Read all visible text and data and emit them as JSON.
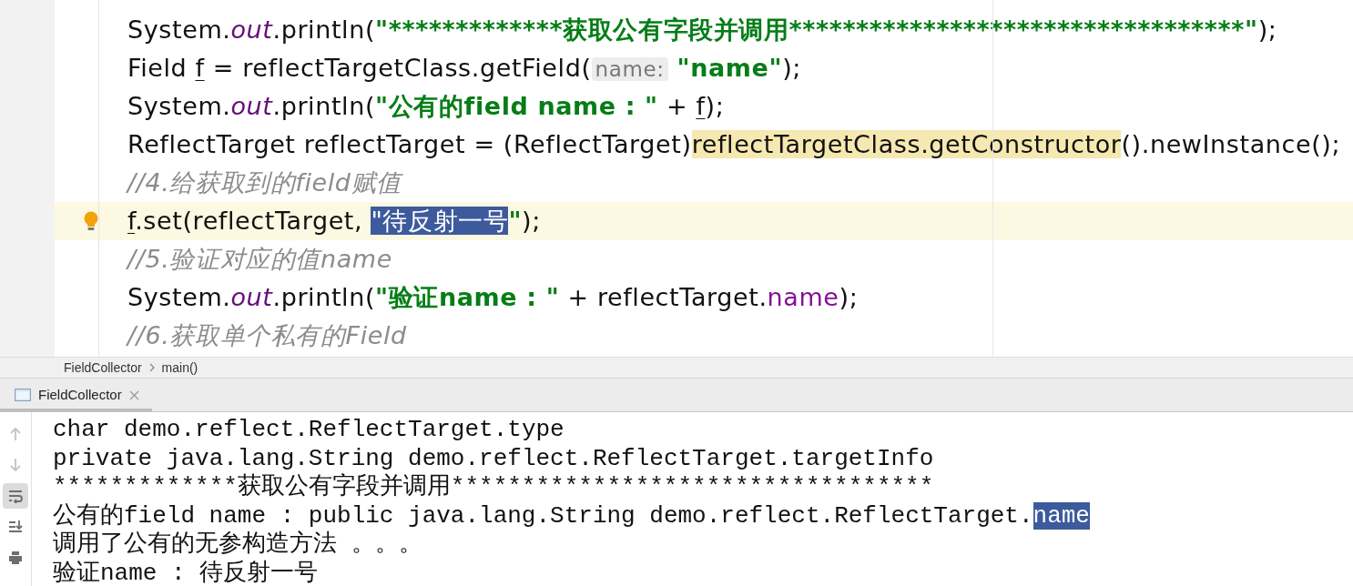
{
  "editor": {
    "lines": [
      {
        "current": false,
        "tokens": [
          {
            "kind": "plain",
            "text": "System."
          },
          {
            "kind": "static",
            "text": "out"
          },
          {
            "kind": "plain",
            "text": ".println("
          },
          {
            "kind": "string",
            "text": "\"*************获取公有字段并调用**********************************\""
          },
          {
            "kind": "plain",
            "text": ");"
          }
        ]
      },
      {
        "current": false,
        "tokens": [
          {
            "kind": "plain",
            "text": "Field "
          },
          {
            "kind": "var",
            "text": "f"
          },
          {
            "kind": "plain",
            "text": " = reflectTargetClass.getField("
          },
          {
            "kind": "hint",
            "text": "name:"
          },
          {
            "kind": "string",
            "text": "\"name\""
          },
          {
            "kind": "plain",
            "text": ");"
          }
        ]
      },
      {
        "current": false,
        "tokens": [
          {
            "kind": "plain",
            "text": "System."
          },
          {
            "kind": "static",
            "text": "out"
          },
          {
            "kind": "plain",
            "text": ".println("
          },
          {
            "kind": "string",
            "text": "\"公有的field name : \""
          },
          {
            "kind": "plain",
            "text": " + "
          },
          {
            "kind": "var",
            "text": "f"
          },
          {
            "kind": "plain",
            "text": ");"
          }
        ]
      },
      {
        "current": false,
        "tokens": [
          {
            "kind": "plain",
            "text": "ReflectTarget reflectTarget = (ReflectTarget)"
          },
          {
            "kind": "highlight",
            "text": "reflectTargetClass.getConstructor"
          },
          {
            "kind": "plain",
            "text": "().newInstance();"
          }
        ]
      },
      {
        "current": false,
        "tokens": [
          {
            "kind": "comment",
            "text": "//4.给获取到的field赋值"
          }
        ]
      },
      {
        "current": true,
        "tokens": [
          {
            "kind": "var",
            "text": "f"
          },
          {
            "kind": "plain",
            "text": ".set(reflectTarget, "
          },
          {
            "kind": "selected",
            "text": "\"待反射一号"
          },
          {
            "kind": "string",
            "text": "\""
          },
          {
            "kind": "plain",
            "text": ");"
          }
        ]
      },
      {
        "current": false,
        "tokens": [
          {
            "kind": "comment",
            "text": "//5.验证对应的值name"
          }
        ]
      },
      {
        "current": false,
        "tokens": [
          {
            "kind": "plain",
            "text": "System."
          },
          {
            "kind": "static",
            "text": "out"
          },
          {
            "kind": "plain",
            "text": ".println("
          },
          {
            "kind": "string",
            "text": "\"验证name : \""
          },
          {
            "kind": "plain",
            "text": " + reflectTarget."
          },
          {
            "kind": "field",
            "text": "name"
          },
          {
            "kind": "plain",
            "text": ");"
          }
        ]
      },
      {
        "current": false,
        "tokens": [
          {
            "kind": "comment",
            "text": "//6.获取单个私有的Field"
          }
        ]
      }
    ]
  },
  "breadcrumb": [
    "FieldCollector",
    "main()"
  ],
  "run_tabs": [
    {
      "label": "FieldCollector",
      "selected": true
    }
  ],
  "console": {
    "tools": [
      {
        "kind": "up",
        "disabled": true,
        "selected": false
      },
      {
        "kind": "down",
        "disabled": true,
        "selected": false
      },
      {
        "kind": "wrap",
        "disabled": false,
        "selected": true
      },
      {
        "kind": "scroll",
        "disabled": false,
        "selected": false
      },
      {
        "kind": "print",
        "disabled": false,
        "selected": false
      }
    ],
    "lines": [
      [
        {
          "kind": "plain",
          "text": "char demo.reflect.ReflectTarget.type"
        }
      ],
      [
        {
          "kind": "plain",
          "text": "private java.lang.String demo.reflect.ReflectTarget.targetInfo"
        }
      ],
      [
        {
          "kind": "plain",
          "text": "*************获取公有字段并调用**********************************"
        }
      ],
      [
        {
          "kind": "plain",
          "text": "公有的field name : public java.lang.String demo.reflect.ReflectTarget."
        },
        {
          "kind": "selected",
          "text": "name"
        }
      ],
      [
        {
          "kind": "plain",
          "text": "调用了公有的无参构造方法 。。。"
        }
      ],
      [
        {
          "kind": "plain",
          "text": "验证name : 待反射一号"
        }
      ]
    ]
  }
}
